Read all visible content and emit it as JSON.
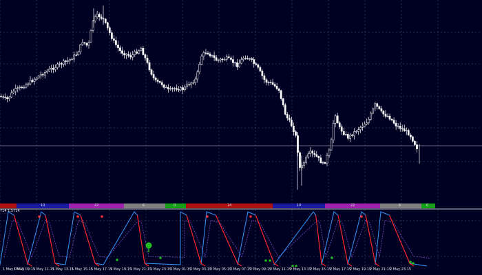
{
  "colors": {
    "background": "#000022",
    "candle": "#ffffff",
    "grid": "#5a5a6e",
    "price_line": "#8c8c9c",
    "fast_line": "#3399ff",
    "slow_line": "#7a4cc8",
    "oversold_line": "#ff2020",
    "signal_up": "#22bb22",
    "signal_down": "#ff3030",
    "session_red": "#b01010",
    "session_blue": "#1a1aa0",
    "session_magenta": "#a020b0",
    "session_gray": "#808080",
    "session_green": "#15a015"
  },
  "indicator": {
    "label": "714 1.5714"
  },
  "session_bar": {
    "segments": [
      {
        "color": "red",
        "label": ""
      },
      {
        "color": "blue",
        "label": "10"
      },
      {
        "color": "magenta",
        "label": "22"
      },
      {
        "color": "gray",
        "label": "6"
      },
      {
        "color": "green",
        "label": "0"
      },
      {
        "color": "red",
        "label": "14"
      },
      {
        "color": "blue",
        "label": "10"
      },
      {
        "color": "magenta",
        "label": "22"
      },
      {
        "color": "gray",
        "label": "6"
      },
      {
        "color": "green",
        "label": "0"
      }
    ]
  },
  "time_axis": {
    "labels": [
      "1 May 05:15",
      "1 May 09:15",
      "1 May 11:15",
      "1 May 13:15",
      "1 May 15:15",
      "1 May 17:15",
      "1 May 19:15",
      "1 May 21:15",
      "1 May 23:15",
      "2 May 01:15",
      "2 May 03:15",
      "2 May 05:15",
      "2 May 07:15",
      "2 May 09:15",
      "2 May 11:15",
      "2 May 13:15",
      "2 May 15:15",
      "2 May 17:15",
      "2 May 19:15",
      "2 May 21:15",
      "2 May 23:15"
    ]
  },
  "price_chart": {
    "candle_count": 200,
    "up_candle_style": "hollow",
    "down_candle_style": "filled"
  }
}
